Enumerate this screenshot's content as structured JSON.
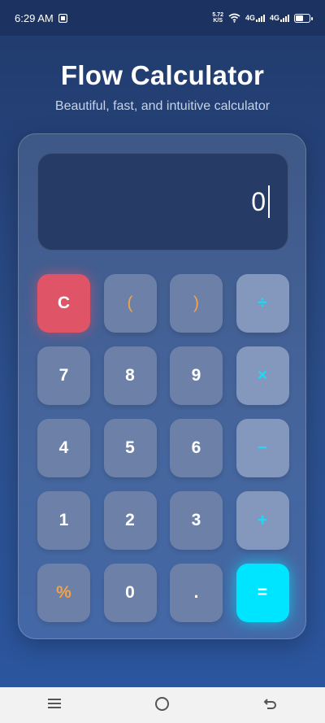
{
  "status_bar": {
    "time": "6:29 AM",
    "speed_value": "5.72",
    "speed_unit": "K/S",
    "network_1": "4G",
    "network_2": "4G",
    "battery_level": 0.6
  },
  "header": {
    "title": "Flow Calculator",
    "subtitle": "Beautiful, fast, and intuitive calculator"
  },
  "display": {
    "value": "0"
  },
  "keys": {
    "clear": "C",
    "open_paren": "(",
    "close_paren": ")",
    "divide": "÷",
    "seven": "7",
    "eight": "8",
    "nine": "9",
    "multiply": "×",
    "four": "4",
    "five": "5",
    "six": "6",
    "minus": "−",
    "one": "1",
    "two": "2",
    "three": "3",
    "plus": "+",
    "percent": "%",
    "zero": "0",
    "decimal": ".",
    "equals": "="
  },
  "colors": {
    "accent": "#00e5ff",
    "clear": "#e05468",
    "paren_percent": "#f2a24a"
  },
  "nav_bar": {
    "icons": [
      "menu-icon",
      "home-icon",
      "back-icon"
    ]
  }
}
